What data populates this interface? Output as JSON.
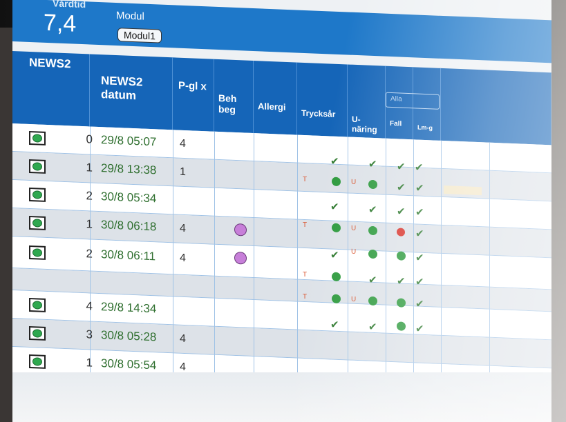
{
  "topbar": {
    "vardtid_label": "Vårdtid",
    "vardtid_value": "7,4",
    "modul_label": "Modul",
    "modul_button": "Modul1"
  },
  "headers": {
    "news2": "NEWS2",
    "news2_datum": "NEWS2 datum",
    "pglx": "P-gl x",
    "behbeg": "Beh beg",
    "allergi": "Allergi",
    "trycksar": "Trycksår",
    "unaring": "U-näring",
    "fall": "Fall",
    "lmg": "Lm-g",
    "filter_label": "Alla"
  },
  "rows": [
    {
      "score": "0",
      "date": "29/8 05:07",
      "pglx": "4"
    },
    {
      "score": "1",
      "date": "29/8 13:38",
      "pglx": "1"
    },
    {
      "score": "2",
      "date": "30/8 05:34",
      "pglx": ""
    },
    {
      "score": "1",
      "date": "30/8 06:18",
      "pglx": "4"
    },
    {
      "score": "2",
      "date": "30/8 06:11",
      "pglx": "4"
    },
    {
      "score": "",
      "date": "",
      "pglx": ""
    },
    {
      "score": "4",
      "date": "29/8 14:34",
      "pglx": ""
    },
    {
      "score": "3",
      "date": "30/8 05:28",
      "pglx": "4"
    },
    {
      "score": "1",
      "date": "30/8 05:54",
      "pglx": "4"
    }
  ],
  "marks": {
    "check": "✔",
    "T": "T",
    "U": "U"
  },
  "colors": {
    "header_blue": "#1565b8",
    "topbar_blue": "#1e78c9",
    "status_green": "#2c9a3c",
    "status_red": "#d9332b",
    "beh_purple": "#c77fd9",
    "date_green": "#2f6f2f"
  }
}
